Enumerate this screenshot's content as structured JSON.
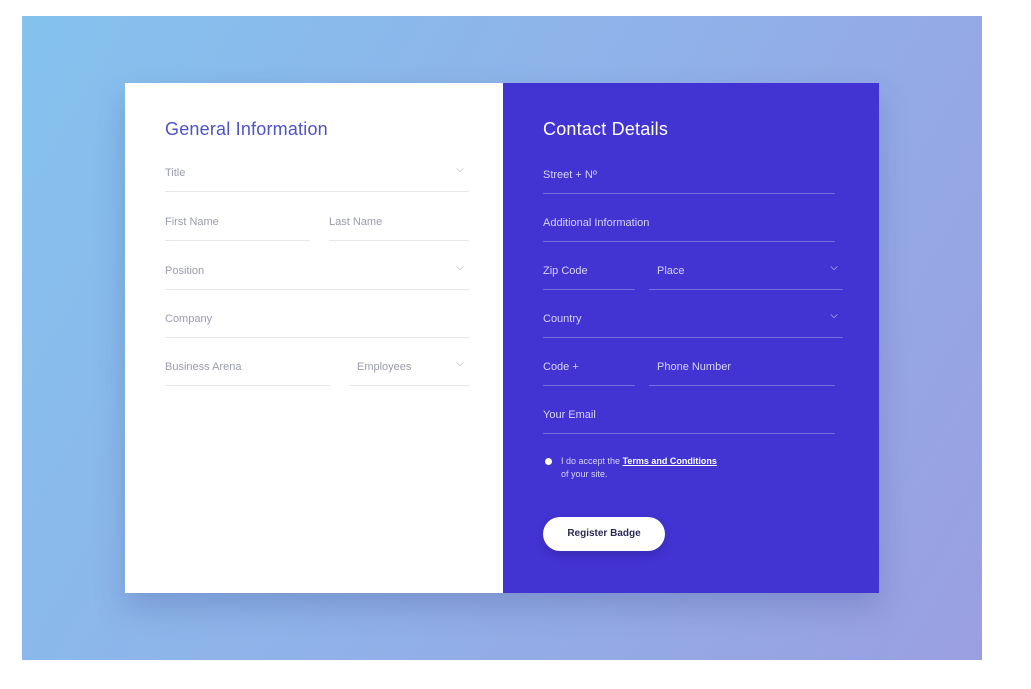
{
  "general": {
    "title": "General Information",
    "fields": {
      "title": "Title",
      "first_name": "First Name",
      "last_name": "Last Name",
      "position": "Position",
      "company": "Company",
      "business_arena": "Business Arena",
      "employees": "Employees"
    }
  },
  "contact": {
    "title": "Contact Details",
    "fields": {
      "street": "Street + Nº",
      "additional": "Additional Information",
      "zip": "Zip Code",
      "place": "Place",
      "country": "Country",
      "code": "Code +",
      "phone": "Phone Number",
      "email": "Your Email"
    },
    "consent_prefix": "I do accept the",
    "consent_link": "Terms and Conditions",
    "consent_suffix": "of your site.",
    "submit": "Register Badge"
  },
  "icons": {
    "dropdown": "chevron-down-icon",
    "radio": "radio-dot-icon"
  },
  "colors": {
    "accent": "#4233d3",
    "heading": "#4d52c8",
    "background_start": "#84c2ee",
    "background_end": "#9a9fe2"
  }
}
